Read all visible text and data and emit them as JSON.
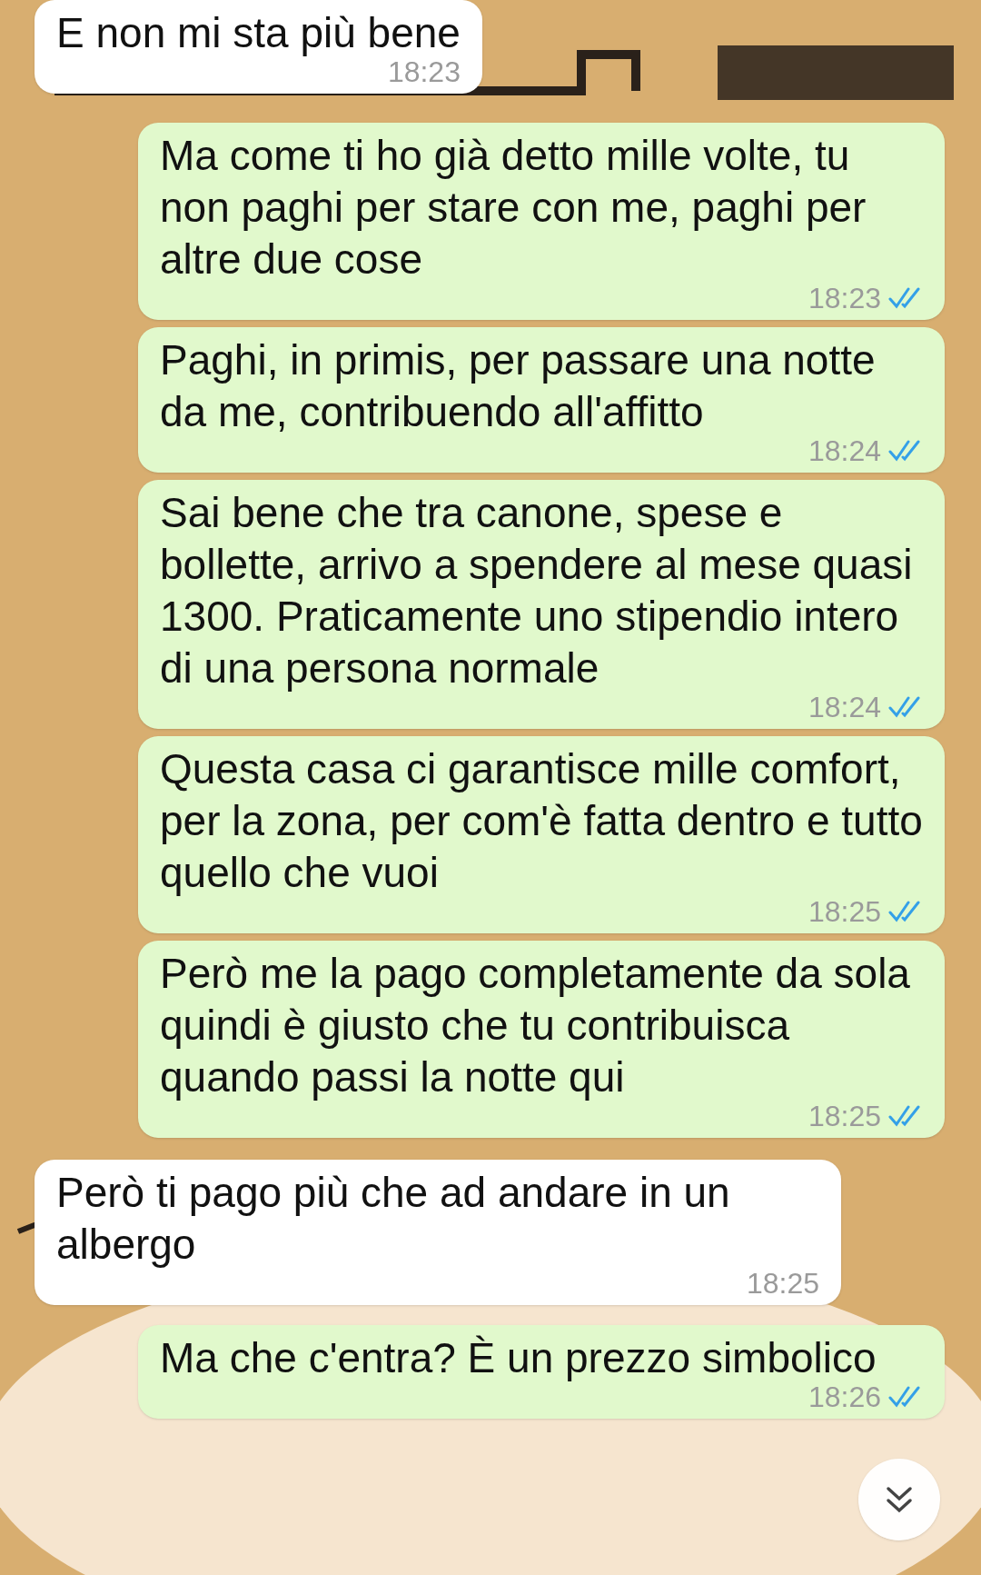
{
  "messages": [
    {
      "kind": "incoming",
      "text": "E non mi sta più bene",
      "time": "18:23"
    },
    {
      "kind": "outgoing",
      "text": "Ma come ti ho già detto mille volte, tu non paghi per stare con me, paghi per altre due cose",
      "time": "18:23",
      "read": true
    },
    {
      "kind": "outgoing",
      "text": "Paghi, in primis, per passare una notte da me, contribuendo all'affitto",
      "time": "18:24",
      "read": true
    },
    {
      "kind": "outgoing",
      "text": "Sai bene che tra canone, spese e bollette, arrivo a spendere al mese quasi 1300. Praticamente uno stipendio intero di una persona normale",
      "time": "18:24",
      "read": true
    },
    {
      "kind": "outgoing",
      "text": "Questa casa ci garantisce mille comfort, per la zona, per com'è fatta dentro e tutto quello che vuoi",
      "time": "18:25",
      "read": true
    },
    {
      "kind": "outgoing",
      "text": "Però me la pago completamente da sola quindi è giusto che tu contribuisca quando passi la notte qui",
      "time": "18:25",
      "read": true
    },
    {
      "kind": "incoming",
      "text": "Però ti pago più che ad andare in un albergo",
      "time": "18:25"
    },
    {
      "kind": "outgoing",
      "text": "Ma che c'entra? È un prezzo simbolico",
      "time": "18:26",
      "read": true
    }
  ]
}
